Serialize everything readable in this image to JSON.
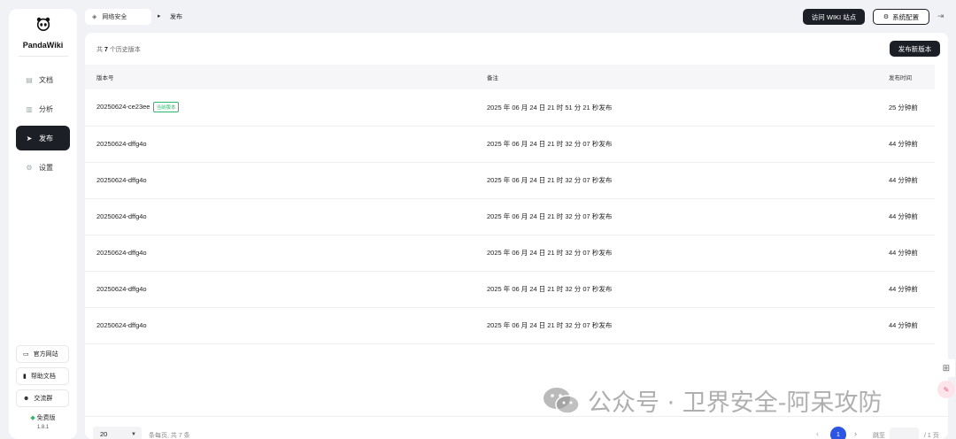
{
  "app": {
    "name": "PandaWiki"
  },
  "sidebar": {
    "items": [
      {
        "label": "文档",
        "icon": "document-icon",
        "active": false
      },
      {
        "label": "分析",
        "icon": "chart-icon",
        "active": false
      },
      {
        "label": "发布",
        "icon": "send-icon",
        "active": true
      },
      {
        "label": "设置",
        "icon": "gear-icon",
        "active": false
      }
    ],
    "links": [
      {
        "label": "官方网站",
        "icon": "monitor-icon"
      },
      {
        "label": "帮助文档",
        "icon": "book-icon"
      },
      {
        "label": "交流群",
        "icon": "group-icon"
      }
    ],
    "plan": "免费版",
    "version": "1.8.1"
  },
  "header": {
    "workspace": "网络安全",
    "separator": "▸",
    "current": "发布",
    "visit_wiki": "访问 WIKI 站点",
    "system_config": "系统配置"
  },
  "main": {
    "total_prefix": "共",
    "total_count": "7",
    "total_suffix": "个历史版本",
    "new_release": "发布新版本",
    "columns": [
      "版本号",
      "备注",
      "发布时间"
    ],
    "current_badge": "当前版本",
    "rows": [
      {
        "version": "20250624-ce23ee",
        "note": "2025 年 06 月 24 日 21 时 51 分 21 秒发布",
        "time": "25 分钟前",
        "current": true
      },
      {
        "version": "20250624-dffg4o",
        "note": "2025 年 06 月 24 日 21 时 32 分 07 秒发布",
        "time": "44 分钟前"
      },
      {
        "version": "20250624-dffg4o",
        "note": "2025 年 06 月 24 日 21 时 32 分 07 秒发布",
        "time": "44 分钟前"
      },
      {
        "version": "20250624-dffg4o",
        "note": "2025 年 06 月 24 日 21 时 32 分 07 秒发布",
        "time": "44 分钟前"
      },
      {
        "version": "20250624-dffg4o",
        "note": "2025 年 06 月 24 日 21 时 32 分 07 秒发布",
        "time": "44 分钟前"
      },
      {
        "version": "20250624-dffg4o",
        "note": "2025 年 06 月 24 日 21 时 32 分 07 秒发布",
        "time": "44 分钟前"
      },
      {
        "version": "20250624-dffg4o",
        "note": "2025 年 06 月 24 日 21 时 32 分 07 秒发布",
        "time": "44 分钟前"
      }
    ]
  },
  "pagination": {
    "page_size": "20",
    "info": "条每页, 共 7 条",
    "current_page": "1",
    "jump_label": "跳至",
    "total_pages": "/ 1 页"
  },
  "watermark": "公众号 · 卫界安全-阿呆攻防",
  "colors": {
    "accent": "#1d1f27",
    "page_active": "#2c55e3",
    "badge": "#2fb86c",
    "background": "#f1f2f6"
  }
}
